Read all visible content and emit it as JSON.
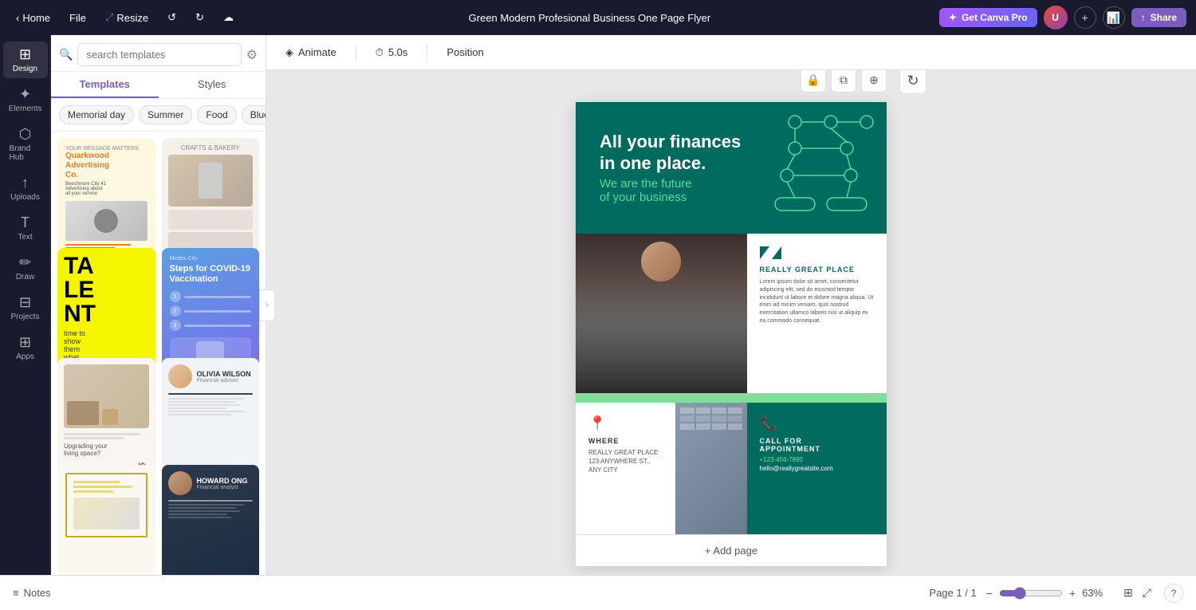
{
  "navbar": {
    "home_label": "Home",
    "file_label": "File",
    "resize_label": "Resize",
    "title": "Green Modern Profesional Business One Page Flyer",
    "canva_pro_label": "Get Canva Pro",
    "share_label": "Share",
    "plus_icon": "+",
    "undo_icon": "↺",
    "redo_icon": "↻",
    "cloud_icon": "☁"
  },
  "sidebar": {
    "items": [
      {
        "id": "design",
        "label": "Design",
        "icon": "⊞"
      },
      {
        "id": "elements",
        "label": "Elements",
        "icon": "✦"
      },
      {
        "id": "brand-hub",
        "label": "Brand Hub",
        "icon": "⬡"
      },
      {
        "id": "uploads",
        "label": "Uploads",
        "icon": "↑"
      },
      {
        "id": "text",
        "label": "Text",
        "icon": "T"
      },
      {
        "id": "draw",
        "label": "Draw",
        "icon": "✏"
      },
      {
        "id": "projects",
        "label": "Projects",
        "icon": "⊟"
      },
      {
        "id": "apps",
        "label": "Apps",
        "icon": "⊞"
      }
    ]
  },
  "panel": {
    "search_placeholder": "search templates",
    "tabs": [
      {
        "id": "templates",
        "label": "Templates"
      },
      {
        "id": "styles",
        "label": "Styles"
      }
    ],
    "active_tab": "templates",
    "filter_chips": [
      {
        "id": "memorial-day",
        "label": "Memorial day"
      },
      {
        "id": "summer",
        "label": "Summer"
      },
      {
        "id": "food",
        "label": "Food"
      },
      {
        "id": "blue",
        "label": "Blue"
      }
    ]
  },
  "toolbar": {
    "animate_label": "Animate",
    "duration_label": "5.0s",
    "position_label": "Position"
  },
  "flyer": {
    "heading_line1": "All your finances",
    "heading_line2": "in one place.",
    "subheading": "We are the future",
    "subheading2": "of your business",
    "company_name": "REALLY GREAT PLACE",
    "description": "Lorem ipsum dolor sit amet, consectetur adipiscing elit, sed do eiusmod tempor incididunt ut labore et dolore magna aliqua. Ut enim ad minim veniam, quis nostrud exercitation ullamco laboris nisi ut aliquip ex ea commodo consequat.",
    "where_label": "WHERE",
    "address_line1": "REALLY GREAT PLACE",
    "address_line2": "123 ANYWHERE ST.,",
    "address_line3": "ANY CITY",
    "call_label": "CALL FOR",
    "appointment_label": "APPOINTMENT",
    "phone": "+123-456-7890",
    "email": "hello@reallygreatsite.com",
    "add_page": "+ Add page"
  },
  "bottom_bar": {
    "notes_label": "Notes",
    "page_indicator": "Page 1 / 1",
    "zoom_level": "63%"
  }
}
